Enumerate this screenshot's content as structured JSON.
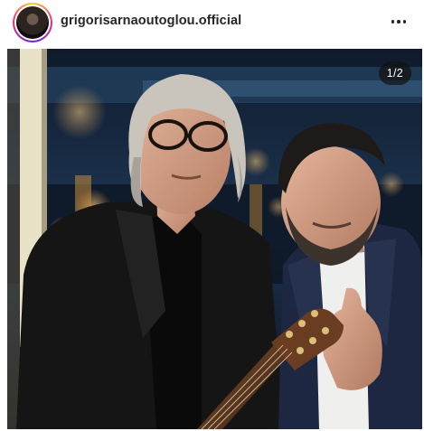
{
  "post": {
    "username": "grigorisarnaoutoglou.official",
    "carousel_counter": "1/2"
  },
  "icons": {
    "more": "more-horizontal-icon"
  }
}
